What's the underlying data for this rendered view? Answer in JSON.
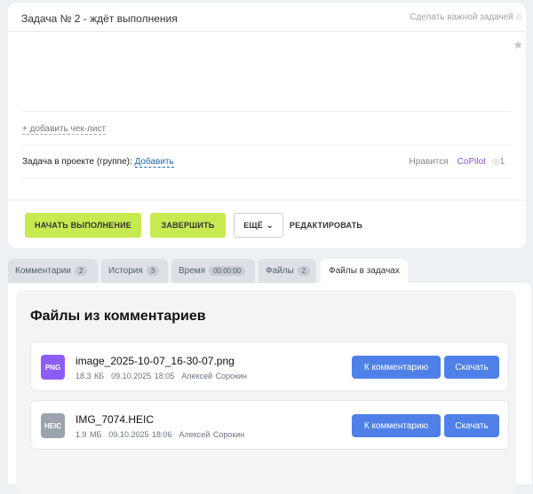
{
  "task": {
    "title": "Задача № 2 - ждёт выполнения",
    "make_important": "Сделать важной задачей",
    "add_checklist": "+ добавить чек-лист",
    "project_label": "Задача в проекте (группе):",
    "project_add": "Добавить",
    "likes_label": "Нравится",
    "liked_by": "CoPilot",
    "views": "1"
  },
  "actions": {
    "start": "НАЧАТЬ ВЫПОЛНЕНИЕ",
    "finish": "ЗАВЕРШИТЬ",
    "more": "ЕЩЁ",
    "edit": "РЕДАКТИРОВАТЬ"
  },
  "tabs": [
    {
      "label": "Комментарии",
      "badge": "2"
    },
    {
      "label": "История",
      "badge": "3"
    },
    {
      "label": "Время",
      "badge": "00:00:00"
    },
    {
      "label": "Файлы",
      "badge": "2"
    },
    {
      "label": "Файлы в задачах"
    }
  ],
  "files_section": {
    "title": "Файлы из комментариев",
    "to_comment": "К комментарию",
    "download": "Скачать",
    "files": [
      {
        "type": "PNG",
        "color": "#8b5cf6",
        "name": "image_2025-10-07_16-30-07.png",
        "size": "18.3 КБ",
        "date": "09.10.2025 18:05",
        "author": "Алексей Сорокин"
      },
      {
        "type": "HEIC",
        "color": "#9ca3af",
        "name": "IMG_7074.HEIC",
        "size": "1.9 МБ",
        "date": "09.10.2025 18:06",
        "author": "Алексей Сорокин"
      }
    ]
  }
}
